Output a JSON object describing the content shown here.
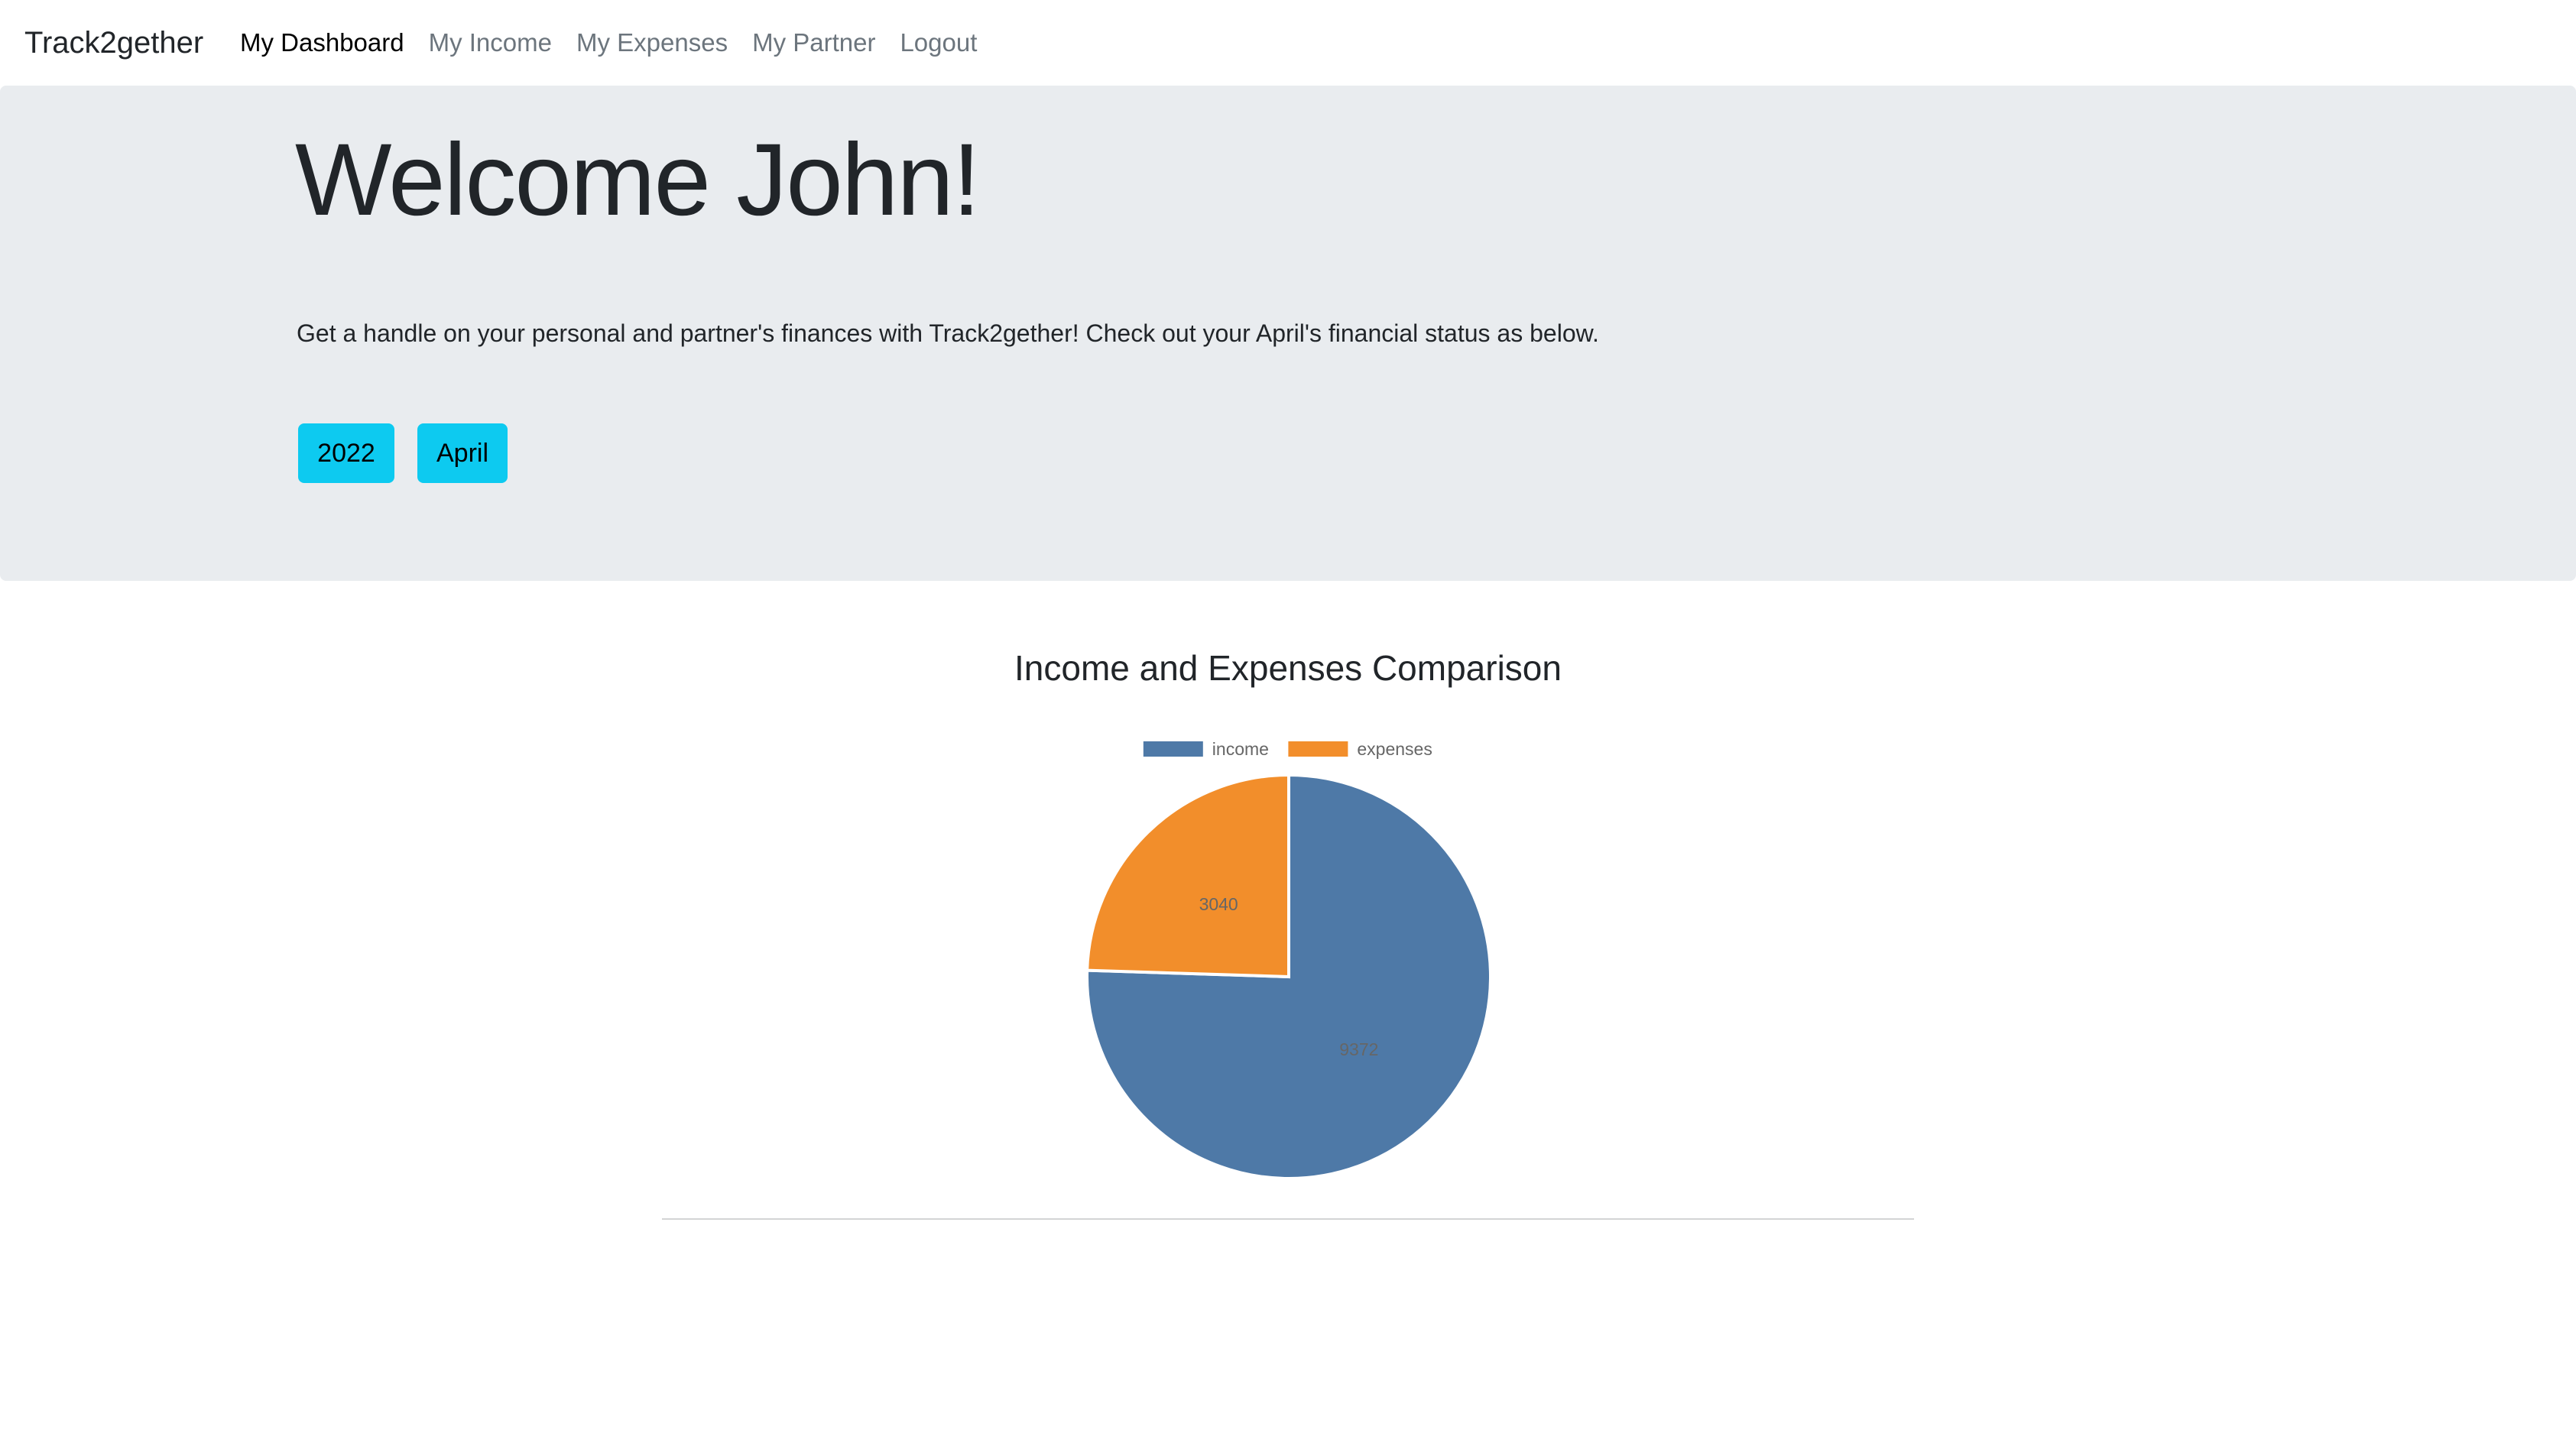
{
  "navbar": {
    "brand": "Track2gether",
    "links": [
      {
        "label": "My Dashboard",
        "active": true
      },
      {
        "label": "My Income",
        "active": false
      },
      {
        "label": "My Expenses",
        "active": false
      },
      {
        "label": "My Partner",
        "active": false
      },
      {
        "label": "Logout",
        "active": false
      }
    ]
  },
  "hero": {
    "title": "Welcome John!",
    "subtitle": "Get a handle on your personal and partner's finances with Track2gether! Check out your April's financial status as below.",
    "year_button": "2022",
    "month_button": "April"
  },
  "chart_section": {
    "title": "Income and Expenses Comparison"
  },
  "colors": {
    "accent_button": "#0dcaf0",
    "hero_bg": "#e9ecef",
    "income": "#4e79a7",
    "expenses": "#f28e2b"
  },
  "chart_data": {
    "type": "pie",
    "title": "Income and Expenses Comparison",
    "legend_position": "top",
    "categories": [
      "income",
      "expenses"
    ],
    "values": [
      9372,
      3040
    ],
    "colors": [
      "#4e79a7",
      "#f28e2b"
    ]
  }
}
